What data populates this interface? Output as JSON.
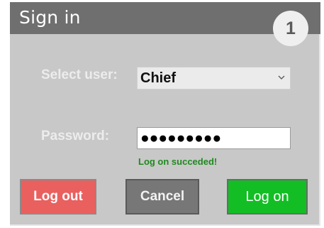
{
  "window": {
    "title": "Sign in",
    "step_badge": "1"
  },
  "form": {
    "user_label": "Select user:",
    "user_value": "Chief",
    "password_label": "Password:",
    "password_value": "●●●●●●●●●",
    "status_text": "Log on succeded!"
  },
  "buttons": {
    "logout_label": "Log out",
    "cancel_label": "Cancel",
    "logon_label": "Log on"
  },
  "icons": {
    "select_arrow": "chevron-down-icon"
  },
  "colors": {
    "titlebar": "#6f6f6f",
    "panel": "#c8c8c8",
    "logout": "#e9605f",
    "cancel": "#777777",
    "logon": "#12be24",
    "status": "#1e8a1e"
  }
}
